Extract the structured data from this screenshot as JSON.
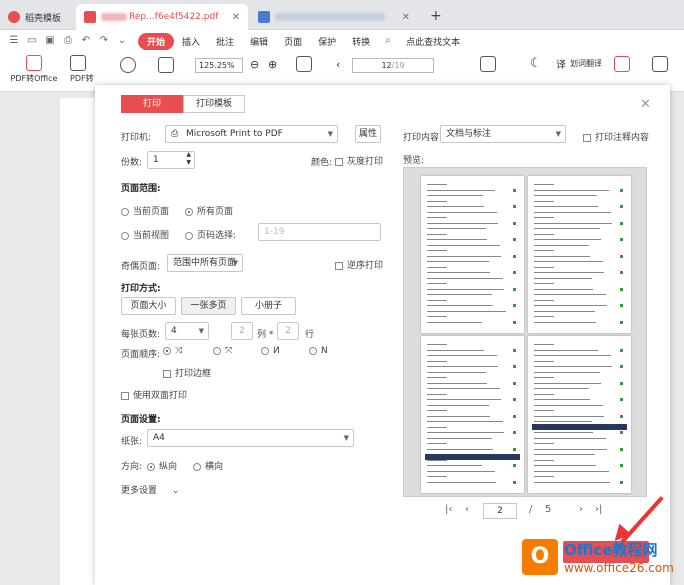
{
  "tabs": [
    {
      "label": "稻壳模板",
      "icon": "wps-logo-icon"
    },
    {
      "label": "Rep...f6e4f5422.pdf",
      "icon": "pdf-icon"
    },
    {
      "label": ""
    }
  ],
  "menu": {
    "items": [
      "开始",
      "插入",
      "批注",
      "编辑",
      "页面",
      "保护",
      "转换"
    ],
    "active_index": 0,
    "search": "点此查找文本"
  },
  "toolbar": {
    "pdf_to_office": "PDF转Office",
    "pdf_to": "PDF转",
    "zoom": "125.25%",
    "page_current": "12",
    "page_total": "19",
    "translate": "划词翻译"
  },
  "dialog": {
    "tabs": [
      "打印",
      "打印模板"
    ],
    "active_tab": 0,
    "printer_label": "打印机:",
    "printer_value": "Microsoft Print to PDF",
    "properties_button": "属性",
    "copies_label": "份数:",
    "copies_value": "1",
    "color_label": "颜色:",
    "grayscale_label": "灰度打印",
    "page_range": {
      "title": "页面范围:",
      "current_page": "当前页面",
      "all_pages": "所有页面",
      "current_view": "当前视图",
      "page_select": "页码选择:",
      "page_select_placeholder": "1-19"
    },
    "odd_even_label": "奇偶页面:",
    "odd_even_value": "范围中所有页面",
    "reverse_label": "逆序打印",
    "print_mode": {
      "title": "打印方式:",
      "buttons": [
        "页面大小",
        "一张多页",
        "小册子"
      ],
      "active": 1
    },
    "pages_per_sheet_label": "每张页数:",
    "pages_per_sheet_value": "4",
    "cols_value": "2",
    "cols_label": "列 *",
    "rows_value": "2",
    "rows_label": "行",
    "page_order_label": "页面顺序:",
    "print_border_label": "打印边框",
    "duplex_label": "使用双面打印",
    "page_setup_title": "页面设置:",
    "paper_label": "纸张:",
    "paper_value": "A4",
    "orientation_label": "方向:",
    "portrait_label": "纵向",
    "landscape_label": "横向",
    "more_settings": "更多设置",
    "print_content_label": "打印内容:",
    "print_content_value": "文档与标注",
    "print_comments_label": "打印注释内容",
    "preview_label": "预览:",
    "pager_current": "2",
    "pager_separator": "/",
    "pager_total": "5"
  },
  "watermark": {
    "logo": "O",
    "brand": "Office教程网",
    "url": "www.office26.com"
  },
  "colors": {
    "accent": "#e84d4f",
    "annotation_arrow": "#e33333"
  }
}
